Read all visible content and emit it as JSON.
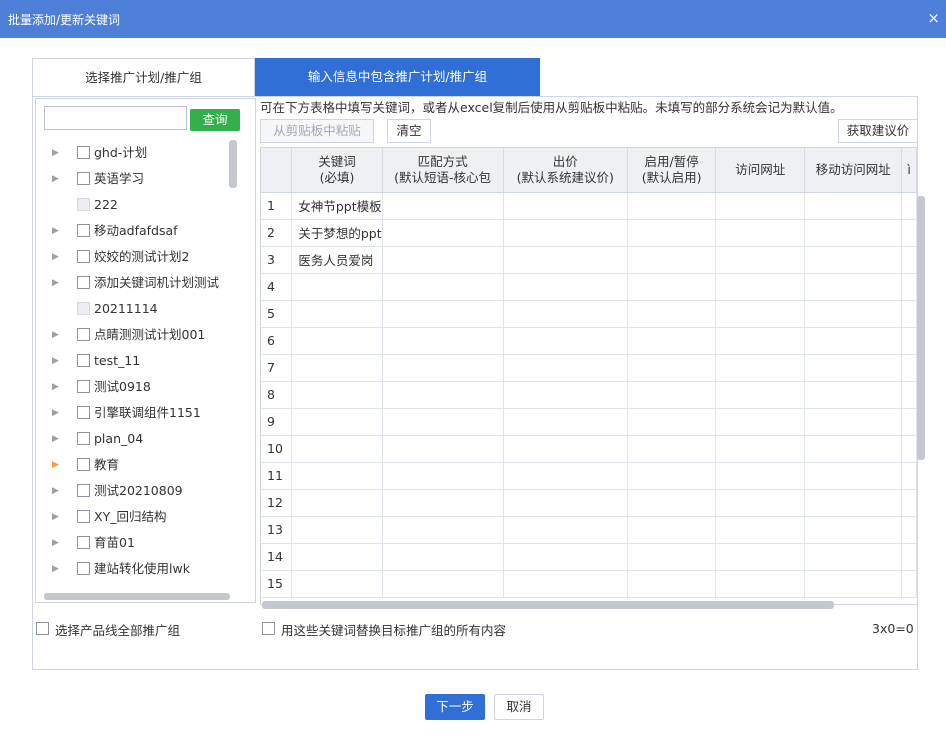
{
  "window": {
    "title": "批量添加/更新关键词",
    "close_glyph": "×"
  },
  "tabs": [
    {
      "label": "选择推广计划/推广组",
      "active": false
    },
    {
      "label": "输入信息中包含推广计划/推广组",
      "active": true
    }
  ],
  "left": {
    "search_value": "",
    "search_button": "查询",
    "tree": [
      {
        "label": "ghd-计划",
        "expandable": true,
        "disabled": false,
        "highlight": false
      },
      {
        "label": "英语学习",
        "expandable": true,
        "disabled": false,
        "highlight": false
      },
      {
        "label": "222",
        "expandable": false,
        "disabled": true,
        "highlight": false
      },
      {
        "label": "移动adfafdsaf",
        "expandable": true,
        "disabled": false,
        "highlight": false
      },
      {
        "label": "姣姣的测试计划2",
        "expandable": true,
        "disabled": false,
        "highlight": false
      },
      {
        "label": "添加关键词机计划测试",
        "expandable": true,
        "disabled": false,
        "highlight": false
      },
      {
        "label": "20211114",
        "expandable": false,
        "disabled": true,
        "highlight": false
      },
      {
        "label": "点睛测测试计划001",
        "expandable": true,
        "disabled": false,
        "highlight": false
      },
      {
        "label": "test_11",
        "expandable": true,
        "disabled": false,
        "highlight": false
      },
      {
        "label": "测试0918",
        "expandable": true,
        "disabled": false,
        "highlight": false
      },
      {
        "label": "引擎联调组件1151",
        "expandable": true,
        "disabled": false,
        "highlight": false
      },
      {
        "label": "plan_04",
        "expandable": true,
        "disabled": false,
        "highlight": false
      },
      {
        "label": "教育",
        "expandable": true,
        "disabled": false,
        "highlight": true
      },
      {
        "label": "测试20210809",
        "expandable": true,
        "disabled": false,
        "highlight": false
      },
      {
        "label": "XY_回归结构",
        "expandable": true,
        "disabled": false,
        "highlight": false
      },
      {
        "label": "育苗01",
        "expandable": true,
        "disabled": false,
        "highlight": false
      },
      {
        "label": "建站转化使用lwk",
        "expandable": true,
        "disabled": false,
        "highlight": false
      }
    ],
    "select_all_label": "选择产品线全部推广组"
  },
  "right": {
    "hint": "可在下方表格中填写关键词，或者从excel复制后使用从剪贴板中粘贴。未填写的部分系统会记为默认值。",
    "paste_button": "从剪贴板中粘贴",
    "clear_button": "清空",
    "suggest_button": "获取建议价",
    "columns": [
      {
        "line1": "",
        "line2": ""
      },
      {
        "line1": "关键词",
        "line2": "(必填)"
      },
      {
        "line1": "匹配方式",
        "line2": "(默认短语-核心包"
      },
      {
        "line1": "出价",
        "line2": "(默认系统建议价)"
      },
      {
        "line1": "启用/暂停",
        "line2": "(默认启用)"
      },
      {
        "line1": "访问网址",
        "line2": ""
      },
      {
        "line1": "移动访问网址",
        "line2": ""
      },
      {
        "line1": "ì",
        "line2": ""
      }
    ],
    "rows": [
      {
        "n": "1",
        "keyword": "女神节ppt模板"
      },
      {
        "n": "2",
        "keyword": "关于梦想的ppt"
      },
      {
        "n": "3",
        "keyword": "医务人员爱岗"
      },
      {
        "n": "4",
        "keyword": ""
      },
      {
        "n": "5",
        "keyword": ""
      },
      {
        "n": "6",
        "keyword": ""
      },
      {
        "n": "7",
        "keyword": ""
      },
      {
        "n": "8",
        "keyword": ""
      },
      {
        "n": "9",
        "keyword": ""
      },
      {
        "n": "10",
        "keyword": ""
      },
      {
        "n": "11",
        "keyword": ""
      },
      {
        "n": "12",
        "keyword": ""
      },
      {
        "n": "13",
        "keyword": ""
      },
      {
        "n": "14",
        "keyword": ""
      },
      {
        "n": "15",
        "keyword": ""
      }
    ],
    "replace_label": "用这些关键词替换目标推广组的所有内容",
    "counter": "3x0=0"
  },
  "footer": {
    "next_button": "下一步",
    "cancel_button": "取消"
  },
  "colors": {
    "titlebar": "#4e7fd8",
    "active_tab": "#2f6fd6",
    "search_button": "#33b04a",
    "highlight_arrow": "#f2a03d"
  },
  "icons": {
    "expand": "triangle-right-icon",
    "close": "close-icon",
    "checkbox": "checkbox-icon"
  }
}
